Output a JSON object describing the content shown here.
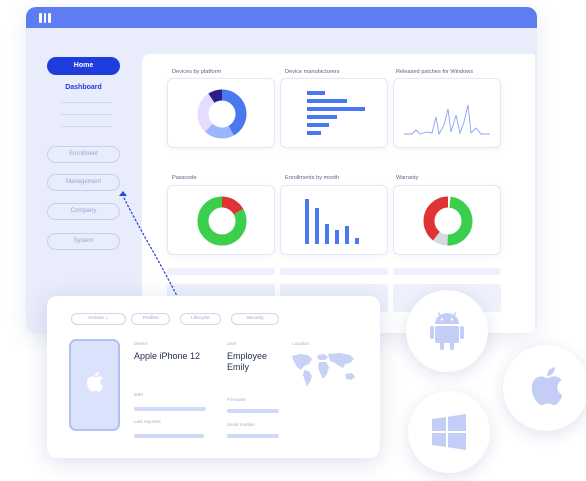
{
  "sidebar": {
    "home": "Home",
    "dashboard": "Dashboard",
    "items": [
      "Enrollment",
      "Management",
      "Company",
      "System"
    ]
  },
  "panels": {
    "devices_by_platform": "Devices by platform",
    "device_manufacturers": "Device manufacturers",
    "released_patches": "Released patches for Windows",
    "passcode": "Passcode",
    "enrollments_by_month": "Enrollments by month",
    "warranty": "Warranty"
  },
  "device_card": {
    "tabs": [
      "Actions",
      "Profiles",
      "Lifecycle",
      "Security"
    ],
    "device_label": "Device",
    "device_value": "Apple iPhone 12",
    "user_label": "User",
    "user_value_line1": "Employee",
    "user_value_line2": "Emily",
    "location_label": "Location",
    "imei_label": "IMEI",
    "firmware_label": "Firmware",
    "last_reported_label": "Last reported",
    "serial_label": "Serial number"
  },
  "os_icons": [
    "android-icon",
    "apple-icon",
    "windows-icon"
  ],
  "colors": {
    "primary": "#1e3ddc",
    "accent": "#5f7df2",
    "green": "#3ccf4e",
    "red": "#e03434",
    "bar_blue": "#4a78f0"
  }
}
